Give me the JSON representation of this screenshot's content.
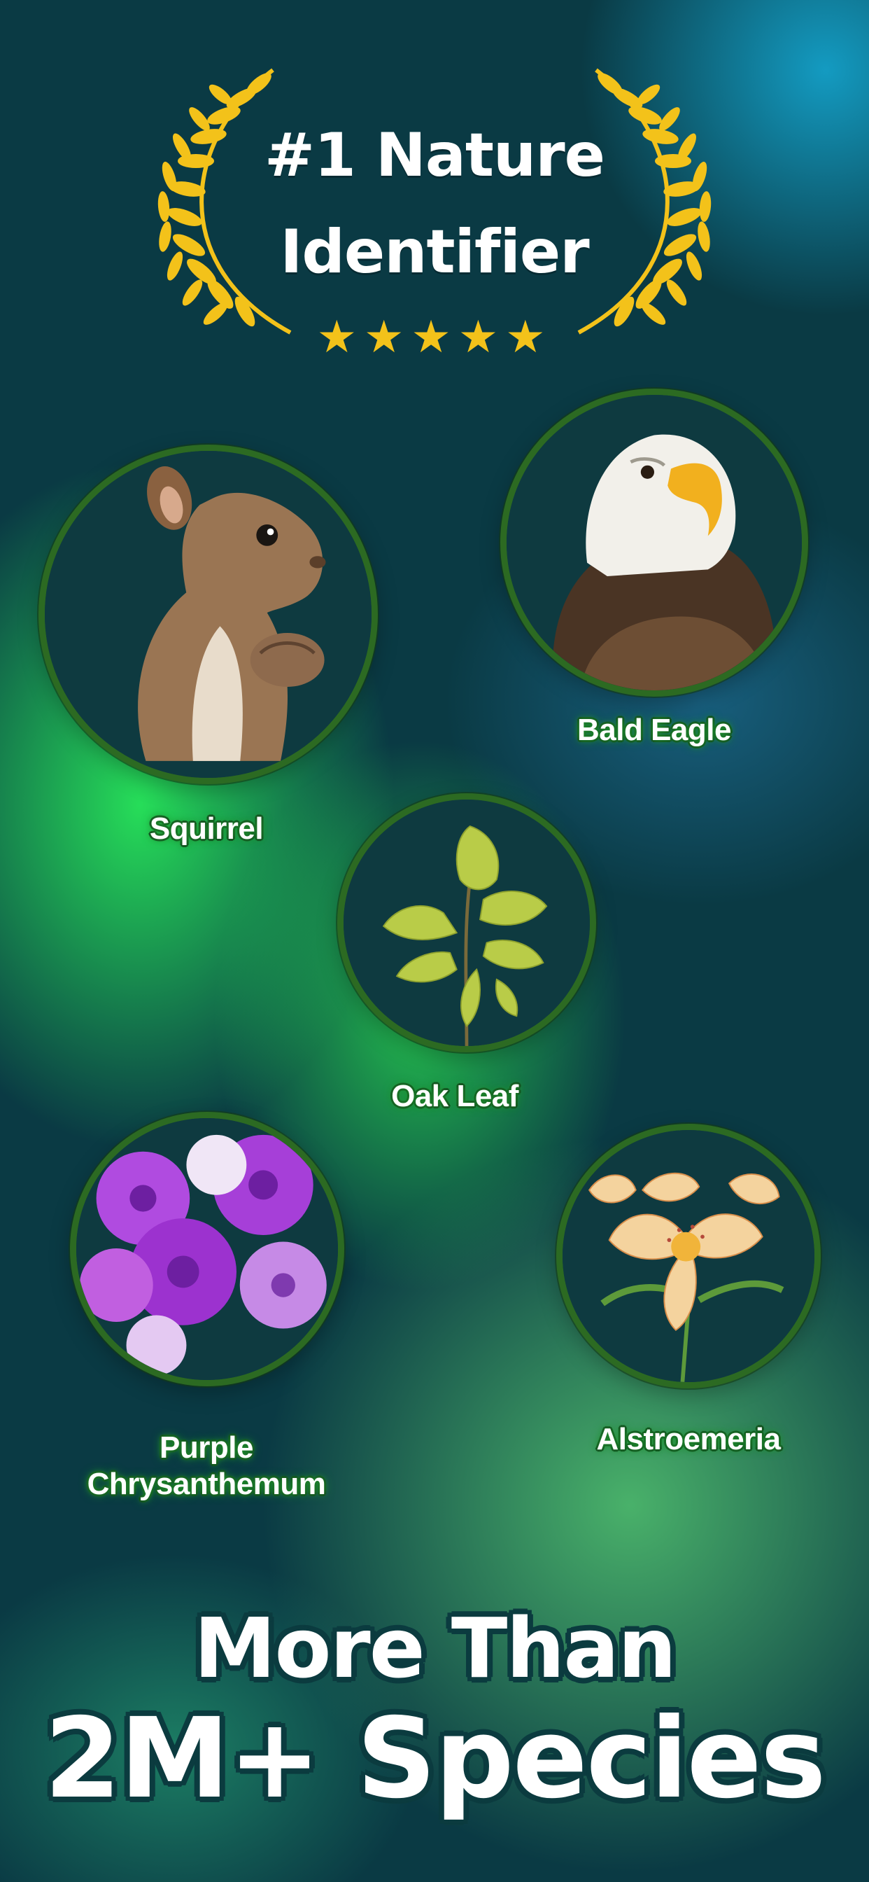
{
  "header": {
    "title_line1": "#1 Nature",
    "title_line2": "Identifier",
    "rating_stars": 5,
    "stars_text": "★★★★★",
    "laurel_color": "#f3c21a"
  },
  "species": [
    {
      "name": "Squirrel",
      "icon": "squirrel-image"
    },
    {
      "name": "Bald Eagle",
      "icon": "bald-eagle-image"
    },
    {
      "name": "Oak Leaf",
      "icon": "oak-leaf-image"
    },
    {
      "name": "Purple Chrysanthemum",
      "icon": "chrysanthemum-image"
    },
    {
      "name": "Alstroemeria",
      "icon": "alstroemeria-image"
    }
  ],
  "label_extra": {
    "purple_line1": "Purple",
    "purple_line2": "Chrysanthemum"
  },
  "footer": {
    "line1": "More Than",
    "line2": "2M+ Species"
  },
  "colors": {
    "ring": "#2c6a22",
    "accent_gold": "#f3c21a",
    "footer_outline": "#0b3b3f"
  }
}
